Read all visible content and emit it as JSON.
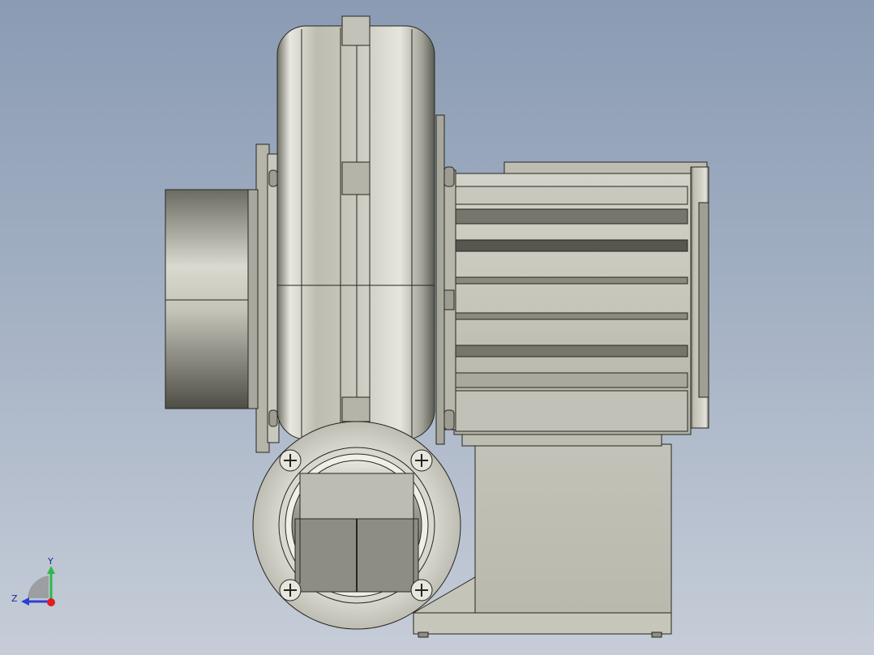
{
  "viewport": {
    "background_top": "#8a9bb3",
    "background_bottom": "#c6cdd8"
  },
  "model": {
    "name_icon": "blower-fan-model",
    "metal_light": "#d6d6cc",
    "metal_mid": "#b9b9ae",
    "metal_dark": "#5d5d55",
    "edge_color": "#26261f"
  },
  "triad": {
    "y_label": "Y",
    "z_label": "Z",
    "y_color": "#2fb84a",
    "z_color": "#2b3fd6",
    "x_color": "#e01b24"
  }
}
